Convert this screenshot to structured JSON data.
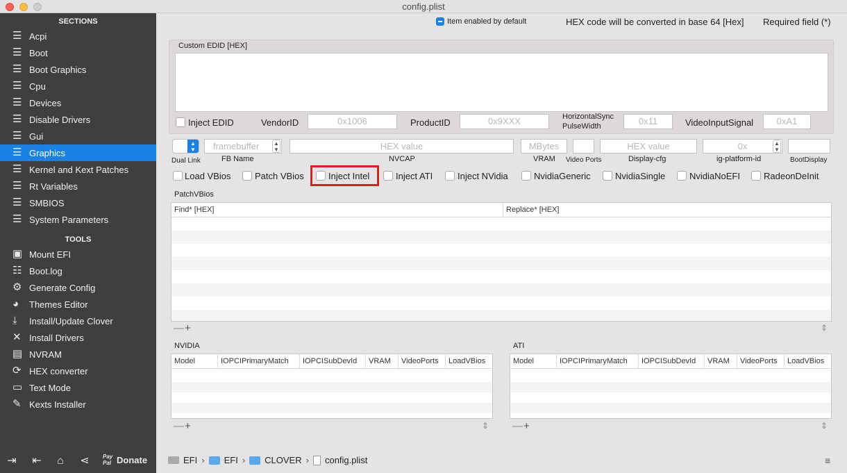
{
  "window": {
    "title": "config.plist"
  },
  "sidebar": {
    "sections_header": "SECTIONS",
    "sections": [
      {
        "label": "Acpi",
        "icon": "list-icon"
      },
      {
        "label": "Boot",
        "icon": "list-icon"
      },
      {
        "label": "Boot Graphics",
        "icon": "list-icon"
      },
      {
        "label": "Cpu",
        "icon": "list-icon"
      },
      {
        "label": "Devices",
        "icon": "list-icon"
      },
      {
        "label": "Disable Drivers",
        "icon": "list-icon"
      },
      {
        "label": "Gui",
        "icon": "list-icon"
      },
      {
        "label": "Graphics",
        "icon": "list-icon",
        "selected": true
      },
      {
        "label": "Kernel and Kext Patches",
        "icon": "list-icon"
      },
      {
        "label": "Rt Variables",
        "icon": "list-icon"
      },
      {
        "label": "SMBIOS",
        "icon": "list-icon"
      },
      {
        "label": "System Parameters",
        "icon": "list-icon"
      }
    ],
    "tools_header": "TOOLS",
    "tools": [
      {
        "label": "Mount EFI",
        "icon": "disk-icon"
      },
      {
        "label": "Boot.log",
        "icon": "log-search-icon"
      },
      {
        "label": "Generate Config",
        "icon": "gears-icon"
      },
      {
        "label": "Themes Editor",
        "icon": "palette-icon"
      },
      {
        "label": "Install/Update Clover",
        "icon": "download-icon"
      },
      {
        "label": "Install Drivers",
        "icon": "wrench-icon"
      },
      {
        "label": "NVRAM",
        "icon": "chip-icon"
      },
      {
        "label": "HEX converter",
        "icon": "convert-icon"
      },
      {
        "label": "Text Mode",
        "icon": "text-icon"
      },
      {
        "label": "Kexts Installer",
        "icon": "kext-icon"
      }
    ],
    "bottom": {
      "donate_brand": "Pay Pal",
      "donate_label": "Donate"
    }
  },
  "topbar": {
    "item_enabled": "Item enabled by default",
    "hex_note": "HEX code will be converted in base 64 [Hex]",
    "required": "Required field (*)"
  },
  "edid": {
    "title": "Custom EDID [HEX]",
    "inject_edid": "Inject EDID",
    "vendor_label": "VendorID",
    "vendor_placeholder": "0x1006",
    "product_label": "ProductID",
    "product_placeholder": "0x9XXX",
    "hsync_label_1": "HorizontalSync",
    "hsync_label_2": "PulseWidth",
    "hsync_placeholder": "0x11",
    "videoinput_label": "VideoInputSignal",
    "videoinput_placeholder": "0xA1"
  },
  "fbrow": {
    "dual_link": "Dual Link",
    "fb_name": "FB Name",
    "fb_placeholder": "framebuffer",
    "nvcap": "NVCAP",
    "nvcap_placeholder": "HEX value",
    "vram": "VRAM",
    "vram_placeholder": "MBytes",
    "video_ports": "Video Ports",
    "display_cfg": "Display-cfg",
    "display_placeholder": "HEX value",
    "ig_platform": "ig-platform-id",
    "ig_placeholder": "0x",
    "boot_display": "BootDisplay"
  },
  "checkboxes": [
    "Load VBios",
    "Patch VBios",
    "Inject Intel",
    "Inject ATI",
    "Inject NVidia",
    "NvidiaGeneric",
    "NvidiaSingle",
    "NvidiaNoEFI",
    "RadeonDeInit"
  ],
  "patchvbios": {
    "title": "PatchVBios",
    "columns": [
      "Find* [HEX]",
      "Replace* [HEX]"
    ]
  },
  "nvidia": {
    "title": "NVIDIA",
    "columns": [
      "Model",
      "IOPCIPrimaryMatch",
      "IOPCISubDevId",
      "VRAM",
      "VideoPorts",
      "LoadVBios"
    ]
  },
  "ati": {
    "title": "ATI",
    "columns": [
      "Model",
      "IOPCIPrimaryMatch",
      "IOPCISubDevId",
      "VRAM",
      "VideoPorts",
      "LoadVBios"
    ]
  },
  "table_controls": {
    "minus": "—",
    "plus": "+"
  },
  "breadcrumb": [
    {
      "label": "EFI",
      "icon": "disk-icon"
    },
    {
      "label": "EFI",
      "icon": "folder-icon"
    },
    {
      "label": "CLOVER",
      "icon": "folder-icon"
    },
    {
      "label": "config.plist",
      "icon": "file-icon"
    }
  ],
  "breadcrumb_sep": "›",
  "colors": {
    "accent": "#1a82e5",
    "highlight": "#e21b1b",
    "sidebar": "#3f3f3f"
  }
}
